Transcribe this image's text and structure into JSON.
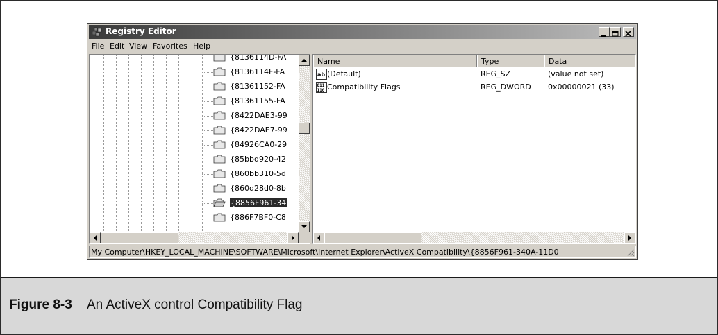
{
  "window": {
    "title": "Registry Editor"
  },
  "menu": [
    "File",
    "Edit",
    "View",
    "Favorites",
    "Help"
  ],
  "tree": {
    "items": [
      "{8136114D-FA",
      "{8136114F-FA",
      "{81361152-FA",
      "{81361155-FA",
      "{8422DAE3-99",
      "{8422DAE7-99",
      "{84926CA0-29",
      "{85bbd920-42",
      "{860bb310-5d",
      "{860d28d0-8b",
      "{8856F961-34",
      "{886F7BF0-C8"
    ],
    "selected_index": 10
  },
  "list": {
    "columns": [
      "Name",
      "Type",
      "Data"
    ],
    "rows": [
      {
        "icon": "string-value-icon",
        "name": "(Default)",
        "type": "REG_SZ",
        "data": "(value not set)"
      },
      {
        "icon": "binary-value-icon",
        "name": "Compatibility Flags",
        "type": "REG_DWORD",
        "data": "0x00000021 (33)"
      }
    ]
  },
  "status_path": "My Computer\\HKEY_LOCAL_MACHINE\\SOFTWARE\\Microsoft\\Internet Explorer\\ActiveX Compatibility\\{8856F961-340A-11D0",
  "caption": {
    "figure": "Figure 8-3",
    "text": "An ActiveX control Compatibility Flag"
  }
}
